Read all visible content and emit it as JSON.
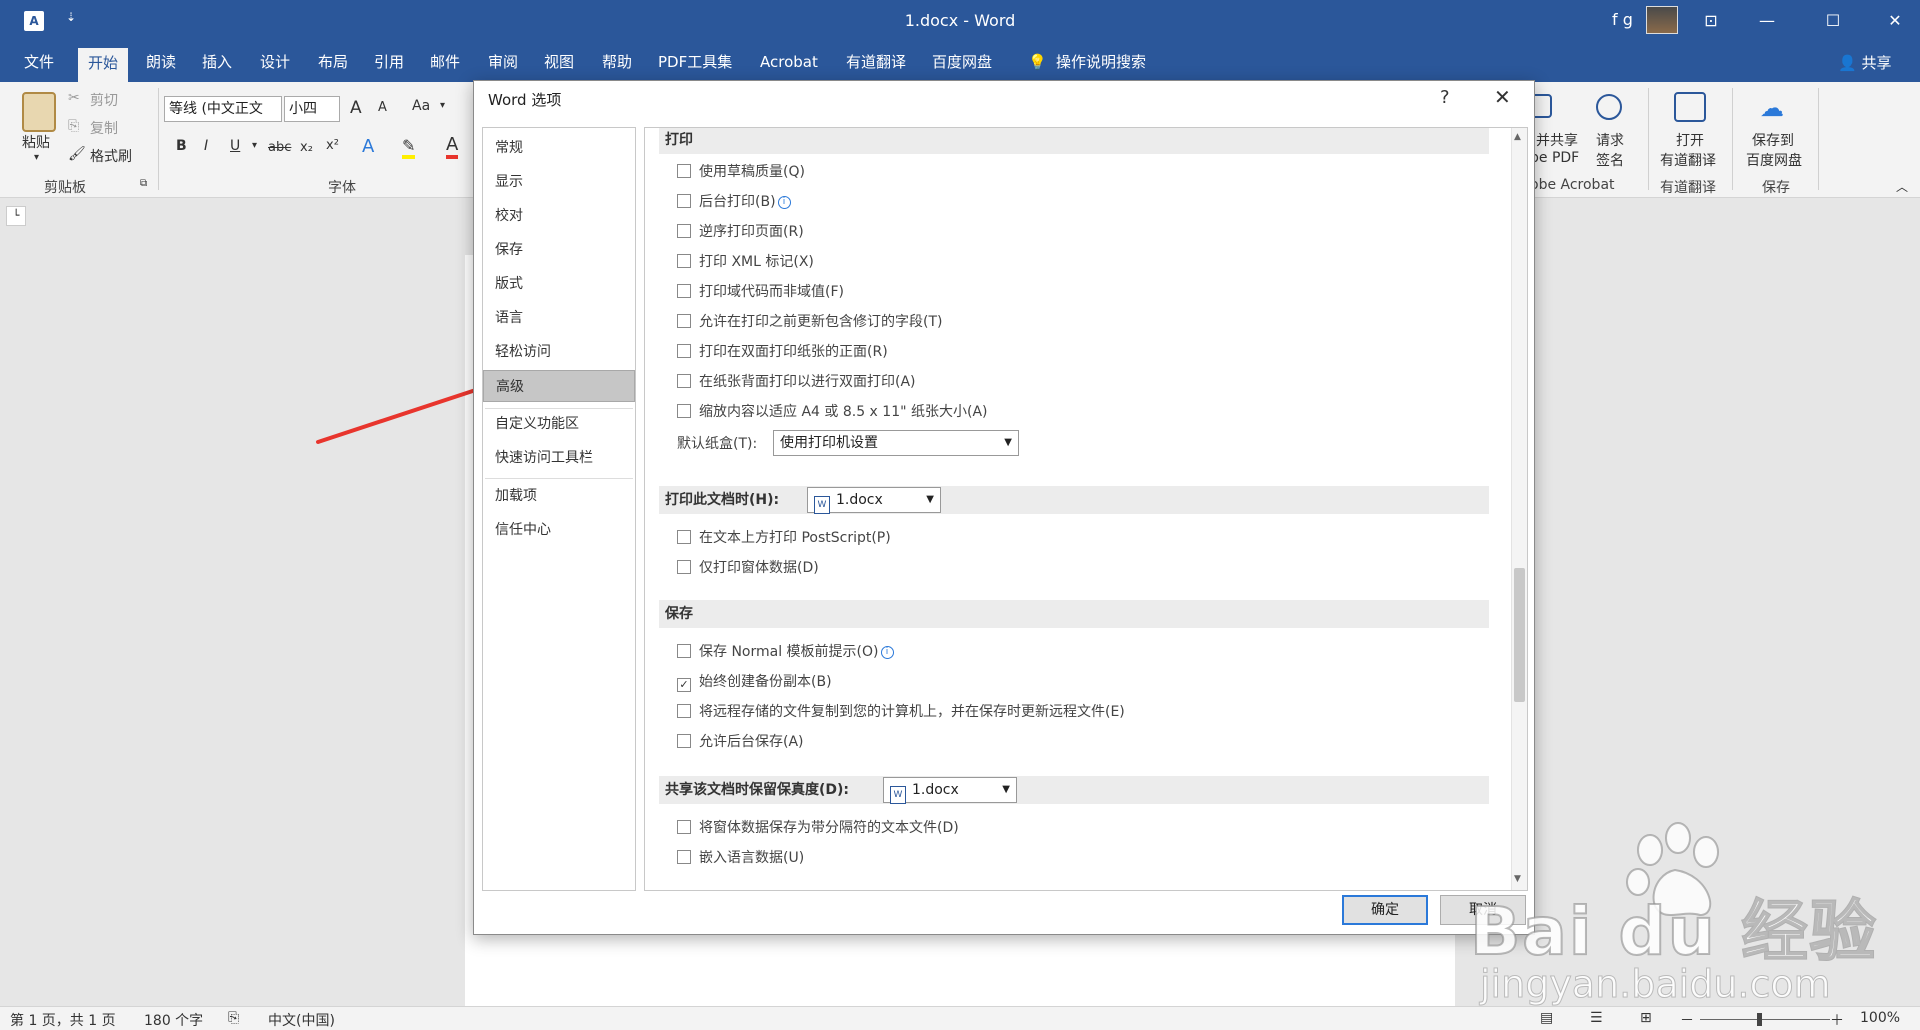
{
  "window": {
    "title": "1.docx - Word",
    "user": "f g",
    "app_icon": "A",
    "qat": "⇣"
  },
  "tabs": [
    "文件",
    "开始",
    "朗读",
    "插入",
    "设计",
    "布局",
    "引用",
    "邮件",
    "审阅",
    "视图",
    "帮助",
    "PDF工具集",
    "Acrobat",
    "有道翻译",
    "百度网盘",
    "操作说明搜索"
  ],
  "share": "共享",
  "ribbon": {
    "paste": "粘贴",
    "cut": "剪切",
    "copy": "复制",
    "format_painter": "格式刷",
    "clipboard_group": "剪贴板",
    "font_name": "等线 (中文正文",
    "font_size": "小四",
    "font_group": "字体",
    "grow": "A",
    "shrink": "A",
    "case": "Aa",
    "bold": "B",
    "italic": "I",
    "underline": "U",
    "strike": "abc",
    "subscript": "x₂",
    "superscript": "x²",
    "pdf_share_1": "并共享",
    "pdf_share_2": "be PDF",
    "request_1": "请求",
    "request_2": "签名",
    "acrobat_group": "obe Acrobat",
    "youdao_1": "打开",
    "youdao_2": "有道翻译",
    "youdao_group": "有道翻译",
    "baidu_1": "保存到",
    "baidu_2": "百度网盘",
    "baidu_group": "保存"
  },
  "statusbar": {
    "page": "第 1 页，共 1 页",
    "words": "180 个字",
    "language": "中文(中国)",
    "zoom": "100%",
    "minus": "－",
    "plus": "＋"
  },
  "dialog": {
    "title": "Word 选项",
    "help": "?",
    "close": "✕",
    "nav": [
      "常规",
      "显示",
      "校对",
      "保存",
      "版式",
      "语言",
      "轻松访问",
      "高级",
      "自定义功能区",
      "快速访问工具栏",
      "加载项",
      "信任中心"
    ],
    "active_nav": "高级",
    "sections": {
      "print": {
        "header": "打印",
        "options": [
          {
            "label": "使用草稿质量(Q)",
            "checked": false,
            "info": false
          },
          {
            "label": "后台打印(B)",
            "checked": false,
            "info": true
          },
          {
            "label": "逆序打印页面(R)",
            "checked": false,
            "info": false
          },
          {
            "label": "打印 XML 标记(X)",
            "checked": false,
            "info": false
          },
          {
            "label": "打印域代码而非域值(F)",
            "checked": false,
            "info": false
          },
          {
            "label": "允许在打印之前更新包含修订的字段(T)",
            "checked": false,
            "info": false
          },
          {
            "label": "打印在双面打印纸张的正面(R)",
            "checked": false,
            "info": false
          },
          {
            "label": "在纸张背面打印以进行双面打印(A)",
            "checked": false,
            "info": false
          },
          {
            "label": "缩放内容以适应 A4 或 8.5 x 11\" 纸张大小(A)",
            "checked": false,
            "info": false
          }
        ],
        "tray_label": "默认纸盒(T):",
        "tray_value": "使用打印机设置"
      },
      "print_doc": {
        "header": "打印此文档时(H):",
        "doc": "1.docx",
        "options": [
          {
            "label": "在文本上方打印 PostScript(P)",
            "checked": false
          },
          {
            "label": "仅打印窗体数据(D)",
            "checked": false
          }
        ]
      },
      "save": {
        "header": "保存",
        "options": [
          {
            "label": "保存 Normal 模板前提示(O)",
            "checked": false,
            "info": true
          },
          {
            "label": "始终创建备份副本(B)",
            "checked": true,
            "info": false
          },
          {
            "label": "将远程存储的文件复制到您的计算机上，并在保存时更新远程文件(E)",
            "checked": false,
            "info": false
          },
          {
            "label": "允许后台保存(A)",
            "checked": false,
            "info": false
          }
        ]
      },
      "fidelity": {
        "header": "共享该文档时保留保真度(D):",
        "doc": "1.docx",
        "options": [
          {
            "label": "将窗体数据保存为带分隔符的文本文件(D)",
            "checked": false
          },
          {
            "label": "嵌入语言数据(U)",
            "checked": false
          }
        ]
      }
    },
    "ok": "确定",
    "cancel": "取消"
  },
  "watermark": {
    "main": "Bai du 经验",
    "sub": "jingyan.baidu.com"
  },
  "colors": {
    "accent": "#2b579a",
    "arrow": "#e8352d",
    "focus": "#2b79d9"
  }
}
